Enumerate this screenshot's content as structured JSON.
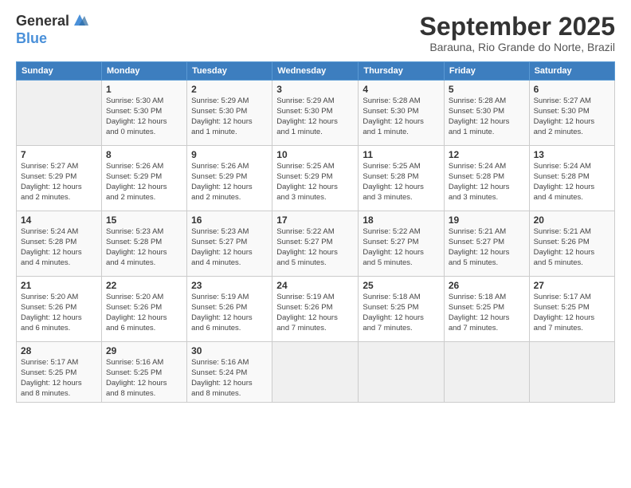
{
  "logo": {
    "line1": "General",
    "line2": "Blue"
  },
  "title": "September 2025",
  "subtitle": "Barauna, Rio Grande do Norte, Brazil",
  "days_of_week": [
    "Sunday",
    "Monday",
    "Tuesday",
    "Wednesday",
    "Thursday",
    "Friday",
    "Saturday"
  ],
  "weeks": [
    [
      {
        "day": "",
        "text": ""
      },
      {
        "day": "1",
        "text": "Sunrise: 5:30 AM\nSunset: 5:30 PM\nDaylight: 12 hours\nand 0 minutes."
      },
      {
        "day": "2",
        "text": "Sunrise: 5:29 AM\nSunset: 5:30 PM\nDaylight: 12 hours\nand 1 minute."
      },
      {
        "day": "3",
        "text": "Sunrise: 5:29 AM\nSunset: 5:30 PM\nDaylight: 12 hours\nand 1 minute."
      },
      {
        "day": "4",
        "text": "Sunrise: 5:28 AM\nSunset: 5:30 PM\nDaylight: 12 hours\nand 1 minute."
      },
      {
        "day": "5",
        "text": "Sunrise: 5:28 AM\nSunset: 5:30 PM\nDaylight: 12 hours\nand 1 minute."
      },
      {
        "day": "6",
        "text": "Sunrise: 5:27 AM\nSunset: 5:30 PM\nDaylight: 12 hours\nand 2 minutes."
      }
    ],
    [
      {
        "day": "7",
        "text": "Sunrise: 5:27 AM\nSunset: 5:29 PM\nDaylight: 12 hours\nand 2 minutes."
      },
      {
        "day": "8",
        "text": "Sunrise: 5:26 AM\nSunset: 5:29 PM\nDaylight: 12 hours\nand 2 minutes."
      },
      {
        "day": "9",
        "text": "Sunrise: 5:26 AM\nSunset: 5:29 PM\nDaylight: 12 hours\nand 2 minutes."
      },
      {
        "day": "10",
        "text": "Sunrise: 5:25 AM\nSunset: 5:29 PM\nDaylight: 12 hours\nand 3 minutes."
      },
      {
        "day": "11",
        "text": "Sunrise: 5:25 AM\nSunset: 5:28 PM\nDaylight: 12 hours\nand 3 minutes."
      },
      {
        "day": "12",
        "text": "Sunrise: 5:24 AM\nSunset: 5:28 PM\nDaylight: 12 hours\nand 3 minutes."
      },
      {
        "day": "13",
        "text": "Sunrise: 5:24 AM\nSunset: 5:28 PM\nDaylight: 12 hours\nand 4 minutes."
      }
    ],
    [
      {
        "day": "14",
        "text": "Sunrise: 5:24 AM\nSunset: 5:28 PM\nDaylight: 12 hours\nand 4 minutes."
      },
      {
        "day": "15",
        "text": "Sunrise: 5:23 AM\nSunset: 5:28 PM\nDaylight: 12 hours\nand 4 minutes."
      },
      {
        "day": "16",
        "text": "Sunrise: 5:23 AM\nSunset: 5:27 PM\nDaylight: 12 hours\nand 4 minutes."
      },
      {
        "day": "17",
        "text": "Sunrise: 5:22 AM\nSunset: 5:27 PM\nDaylight: 12 hours\nand 5 minutes."
      },
      {
        "day": "18",
        "text": "Sunrise: 5:22 AM\nSunset: 5:27 PM\nDaylight: 12 hours\nand 5 minutes."
      },
      {
        "day": "19",
        "text": "Sunrise: 5:21 AM\nSunset: 5:27 PM\nDaylight: 12 hours\nand 5 minutes."
      },
      {
        "day": "20",
        "text": "Sunrise: 5:21 AM\nSunset: 5:26 PM\nDaylight: 12 hours\nand 5 minutes."
      }
    ],
    [
      {
        "day": "21",
        "text": "Sunrise: 5:20 AM\nSunset: 5:26 PM\nDaylight: 12 hours\nand 6 minutes."
      },
      {
        "day": "22",
        "text": "Sunrise: 5:20 AM\nSunset: 5:26 PM\nDaylight: 12 hours\nand 6 minutes."
      },
      {
        "day": "23",
        "text": "Sunrise: 5:19 AM\nSunset: 5:26 PM\nDaylight: 12 hours\nand 6 minutes."
      },
      {
        "day": "24",
        "text": "Sunrise: 5:19 AM\nSunset: 5:26 PM\nDaylight: 12 hours\nand 7 minutes."
      },
      {
        "day": "25",
        "text": "Sunrise: 5:18 AM\nSunset: 5:25 PM\nDaylight: 12 hours\nand 7 minutes."
      },
      {
        "day": "26",
        "text": "Sunrise: 5:18 AM\nSunset: 5:25 PM\nDaylight: 12 hours\nand 7 minutes."
      },
      {
        "day": "27",
        "text": "Sunrise: 5:17 AM\nSunset: 5:25 PM\nDaylight: 12 hours\nand 7 minutes."
      }
    ],
    [
      {
        "day": "28",
        "text": "Sunrise: 5:17 AM\nSunset: 5:25 PM\nDaylight: 12 hours\nand 8 minutes."
      },
      {
        "day": "29",
        "text": "Sunrise: 5:16 AM\nSunset: 5:25 PM\nDaylight: 12 hours\nand 8 minutes."
      },
      {
        "day": "30",
        "text": "Sunrise: 5:16 AM\nSunset: 5:24 PM\nDaylight: 12 hours\nand 8 minutes."
      },
      {
        "day": "",
        "text": ""
      },
      {
        "day": "",
        "text": ""
      },
      {
        "day": "",
        "text": ""
      },
      {
        "day": "",
        "text": ""
      }
    ]
  ]
}
